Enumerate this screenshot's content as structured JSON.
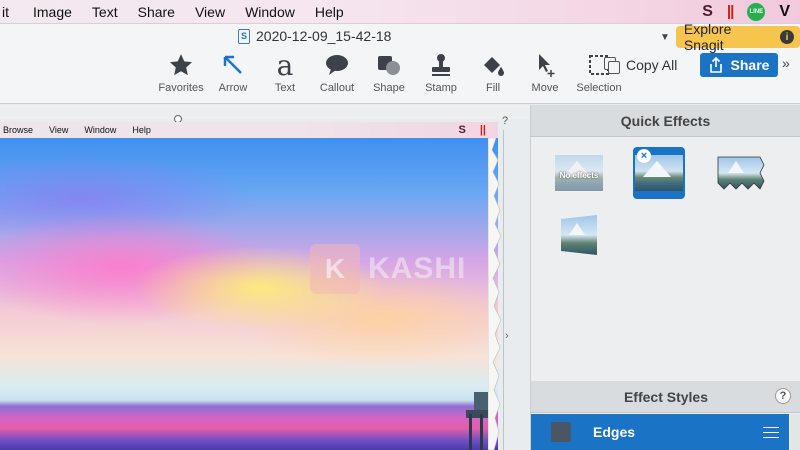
{
  "menubar": {
    "items": [
      "it",
      "Image",
      "Text",
      "Share",
      "View",
      "Window",
      "Help"
    ],
    "status_icons": {
      "snagit": "S",
      "pause": "||",
      "line": "LINE",
      "v": "V"
    }
  },
  "toolbar": {
    "filename": "2020-12-09_15-42-18",
    "file_icon_letter": "S",
    "explore_label": "Explore Snagit",
    "info_glyph": "i",
    "copy_all_label": "Copy All",
    "share_label": "Share",
    "more_glyph": "»",
    "tools": [
      {
        "name": "favorites",
        "label": "Favorites"
      },
      {
        "name": "arrow",
        "label": "Arrow"
      },
      {
        "name": "text",
        "label": "Text"
      },
      {
        "name": "callout",
        "label": "Callout"
      },
      {
        "name": "shape",
        "label": "Shape"
      },
      {
        "name": "stamp",
        "label": "Stamp"
      },
      {
        "name": "fill",
        "label": "Fill"
      },
      {
        "name": "move",
        "label": "Move"
      },
      {
        "name": "selection",
        "label": "Selection"
      }
    ]
  },
  "canvas": {
    "help_glyph": "?",
    "screenshot_menu": [
      "Browse",
      "View",
      "Window",
      "Help"
    ],
    "screenshot_icons": {
      "snagit": "S",
      "pause": "||"
    },
    "watermark": {
      "logo": "K",
      "text": "KASHI"
    }
  },
  "panel": {
    "quick_effects_title": "Quick Effects",
    "no_effects_label": "No effects",
    "remove_glyph": "×",
    "effect_styles_title": "Effect Styles",
    "effect_styles_help": "?",
    "selected_style": "Edges"
  },
  "colors": {
    "accent": "#1b73c5",
    "explore": "#f7c54e"
  }
}
